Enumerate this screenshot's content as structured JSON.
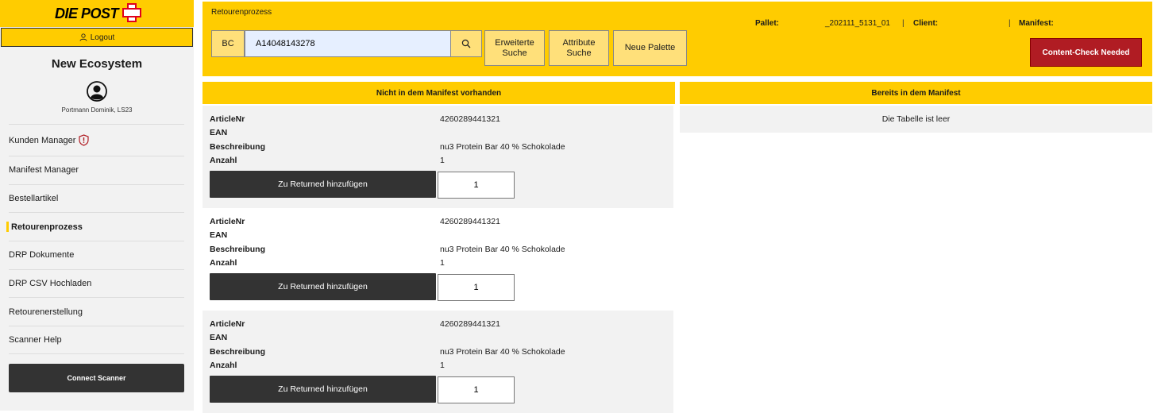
{
  "brand": {
    "logo_text": "DIE POST",
    "accent": "#ffcc00",
    "logo_cross_color": "#e0001b"
  },
  "sidebar": {
    "logout_label": "Logout",
    "app_title": "New Ecosystem",
    "user_name": "Portmann Dominik, LS23",
    "items": [
      {
        "label": "Kunden Manager",
        "icon": "shield-icon"
      },
      {
        "label": "Manifest Manager"
      },
      {
        "label": "Bestellartikel"
      },
      {
        "label": "Retourenprozess",
        "active": true
      },
      {
        "label": "DRP Dokumente"
      },
      {
        "label": "DRP CSV Hochladen"
      },
      {
        "label": "Retourenerstellung"
      },
      {
        "label": "Scanner Help"
      }
    ],
    "connect_label": "Connect Scanner"
  },
  "top": {
    "title": "Retourenprozess",
    "bc_label": "BC",
    "search_value": "A14048143278",
    "btn_advanced_line1": "Erweiterte",
    "btn_advanced_line2": "Suche",
    "btn_attribute_line1": "Attribute",
    "btn_attribute_line2": "Suche",
    "btn_new_pallet": "Neue Palette",
    "pallet_label": "Pallet:",
    "pallet_value": "_202111_5131_01",
    "client_label": "Client:",
    "manifest_label": "Manifest:",
    "content_check_label": "Content-Check Needed",
    "content_check_color": "#b01c23"
  },
  "left_panel": {
    "header": "Nicht in dem Manifest vorhanden",
    "labels": {
      "article": "ArticleNr",
      "ean": "EAN",
      "desc": "Beschreibung",
      "qty": "Anzahl"
    },
    "add_label": "Zu Returned hinzufügen",
    "items": [
      {
        "article": "4260289441321",
        "ean": "",
        "desc": "nu3 Protein Bar 40 % Schokolade",
        "qty": "1",
        "input": "1"
      },
      {
        "article": "4260289441321",
        "ean": "",
        "desc": "nu3 Protein Bar 40 % Schokolade",
        "qty": "1",
        "input": "1"
      },
      {
        "article": "4260289441321",
        "ean": "",
        "desc": "nu3 Protein Bar 40 % Schokolade",
        "qty": "1",
        "input": "1"
      }
    ]
  },
  "right_panel": {
    "header": "Bereits in dem Manifest",
    "empty_text": "Die Tabelle ist leer"
  }
}
